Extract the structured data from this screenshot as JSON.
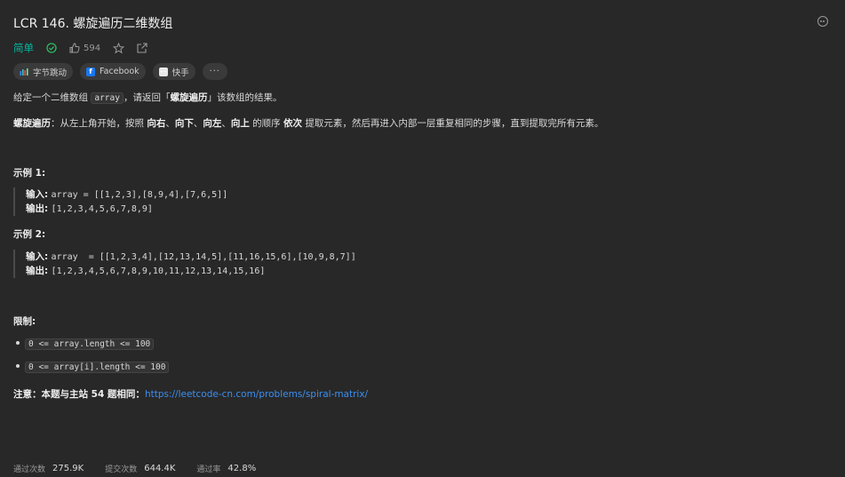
{
  "problem": {
    "title": "LCR 146. 螺旋遍历二维数组",
    "difficulty": "简单",
    "likes": "594"
  },
  "tags": [
    {
      "label": "字节跳动",
      "icon": "bytedance-icon"
    },
    {
      "label": "Facebook",
      "icon": "facebook-icon"
    },
    {
      "label": "快手",
      "icon": "kuaishou-icon"
    },
    {
      "label": "···",
      "icon": "more-tags-icon"
    }
  ],
  "description": {
    "p1_pre": "给定一个二维数组 ",
    "p1_code": "array",
    "p1_mid": "，请返回「",
    "p1_bold": "螺旋遍历",
    "p1_post": "」该数组的结果。",
    "p2_bold": "螺旋遍历",
    "p2_a": "：从左上角开始，按照 ",
    "p2_b1": "向右",
    "p2_s1": "、",
    "p2_b2": "向下",
    "p2_s2": "、",
    "p2_b3": "向左",
    "p2_s3": "、",
    "p2_b4": "向上",
    "p2_c": " 的顺序 ",
    "p2_b5": "依次",
    "p2_d": " 提取元素，然后再进入内部一层重复相同的步骤，直到提取完所有元素。"
  },
  "examples": [
    {
      "heading": "示例 1:",
      "input_label": "输入:",
      "input": "array = [[1,2,3],[8,9,4],[7,6,5]]",
      "output_label": "输出:",
      "output": "[1,2,3,4,5,6,7,8,9]"
    },
    {
      "heading": "示例 2:",
      "input_label": "输入:",
      "input": "array  = [[1,2,3,4],[12,13,14,5],[11,16,15,6],[10,9,8,7]]",
      "output_label": "输出:",
      "output": "[1,2,3,4,5,6,7,8,9,10,11,12,13,14,15,16]"
    }
  ],
  "constraints": {
    "heading": "限制:",
    "items": [
      "0 <= array.length <= 100",
      "0 <= array[i].length <= 100"
    ]
  },
  "note": {
    "label": "注意：本题与主站 54 题相同：",
    "link": "https://leetcode-cn.com/problems/spiral-matrix/"
  },
  "stats": {
    "accepted_label": "通过次数",
    "accepted": "275.9K",
    "submissions_label": "提交次数",
    "submissions": "644.4K",
    "rate_label": "通过率",
    "rate": "42.8%"
  },
  "colors": {
    "background": "#282828",
    "easy": "#00b8a3",
    "link": "#3c8ff0"
  }
}
